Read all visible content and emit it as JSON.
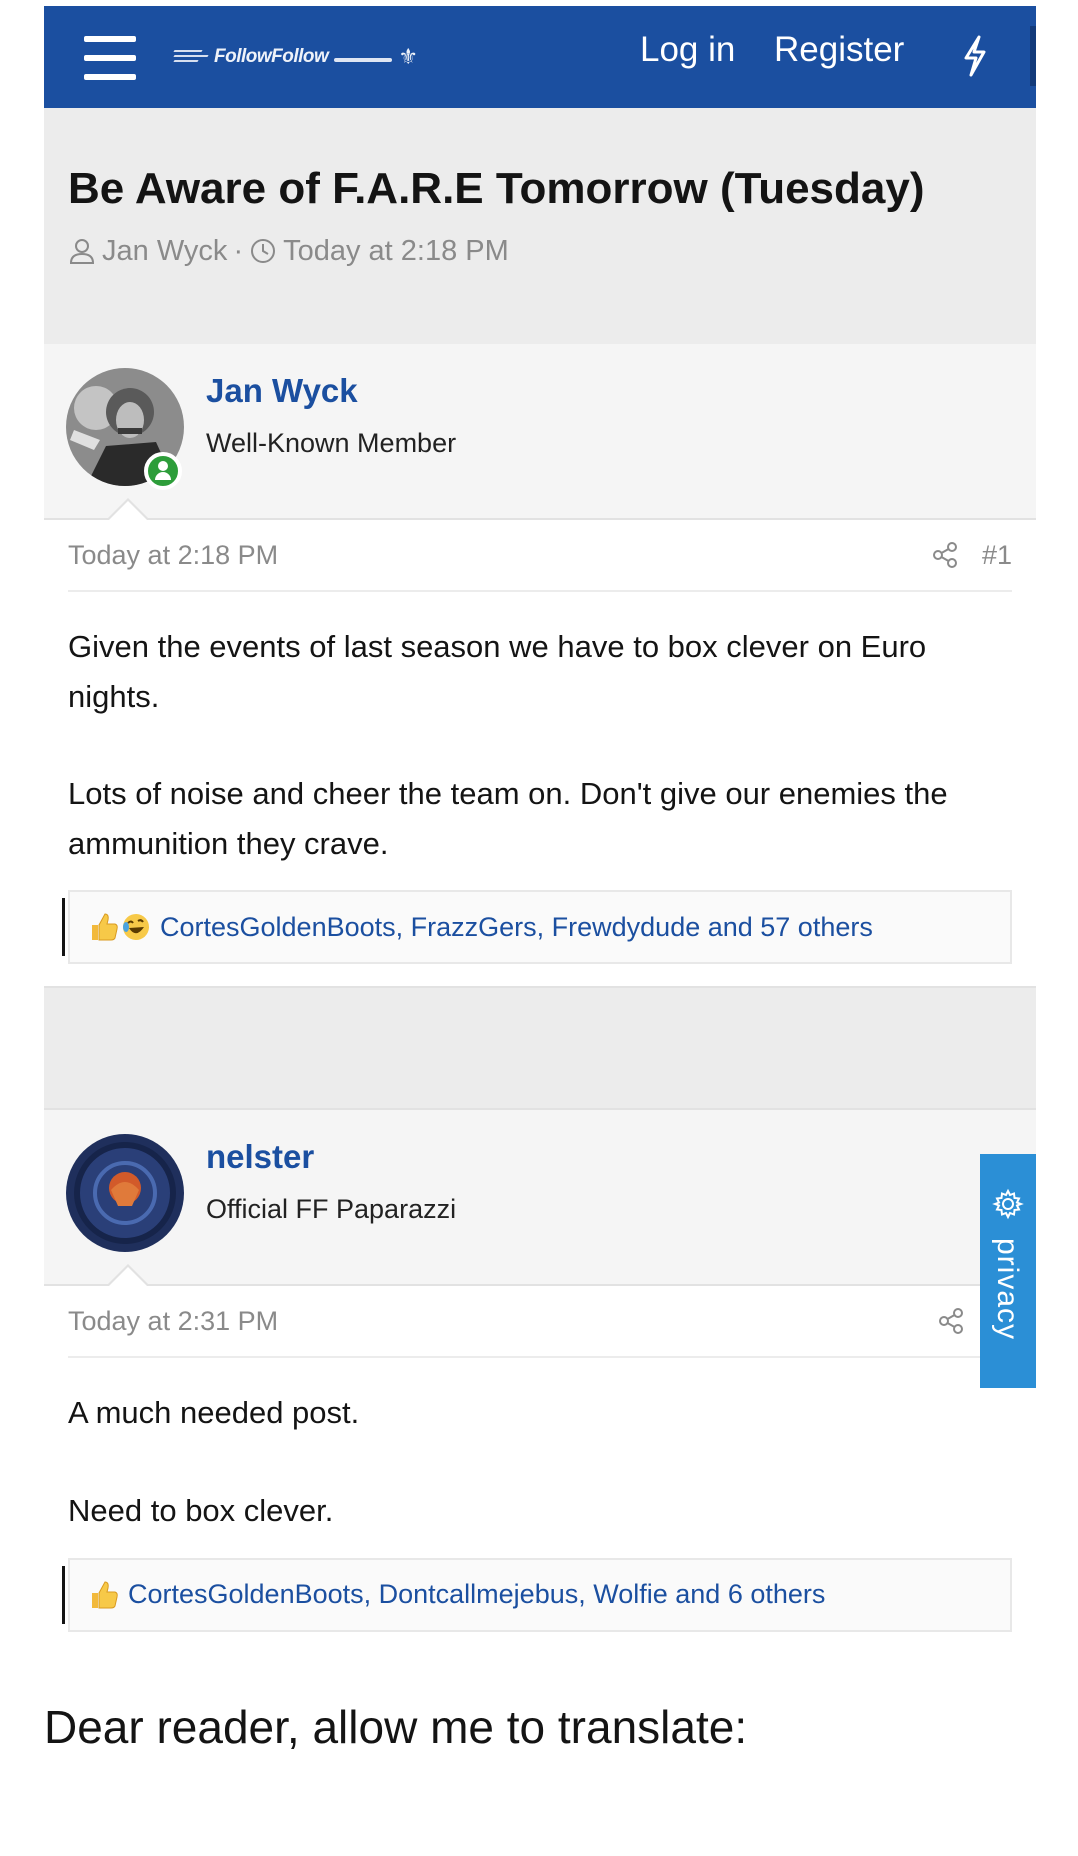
{
  "header": {
    "logo_text": "FollowFollow",
    "login_label": "Log in",
    "register_label": "Register",
    "brand_color": "#1b4fa0"
  },
  "thread": {
    "title": "Be Aware of F.A.R.E Tomorrow (Tuesday)",
    "author": "Jan Wyck",
    "separator": "·",
    "time": "Today at 2:18 PM"
  },
  "posts": [
    {
      "username": "Jan Wyck",
      "user_title": "Well-Known Member",
      "time": "Today at 2:18 PM",
      "post_number": "#1",
      "paragraphs": [
        "Given the events of last season we have to box clever on Euro nights.",
        "Lots of noise and cheer the team on. Don't give our enemies the ammunition they crave."
      ],
      "reactions_text": "CortesGoldenBoots, FrazzGers, Frewdydude and 57 others"
    },
    {
      "username": "nelster",
      "user_title": "Official FF Paparazzi",
      "time": "Today at 2:31 PM",
      "paragraphs": [
        "A much needed post.",
        "Need to box clever."
      ],
      "reactions_text": "CortesGoldenBoots, Dontcallmejebus, Wolfie and 6 others"
    }
  ],
  "privacy_label": "privacy",
  "caption": "Dear reader, allow me to translate:"
}
